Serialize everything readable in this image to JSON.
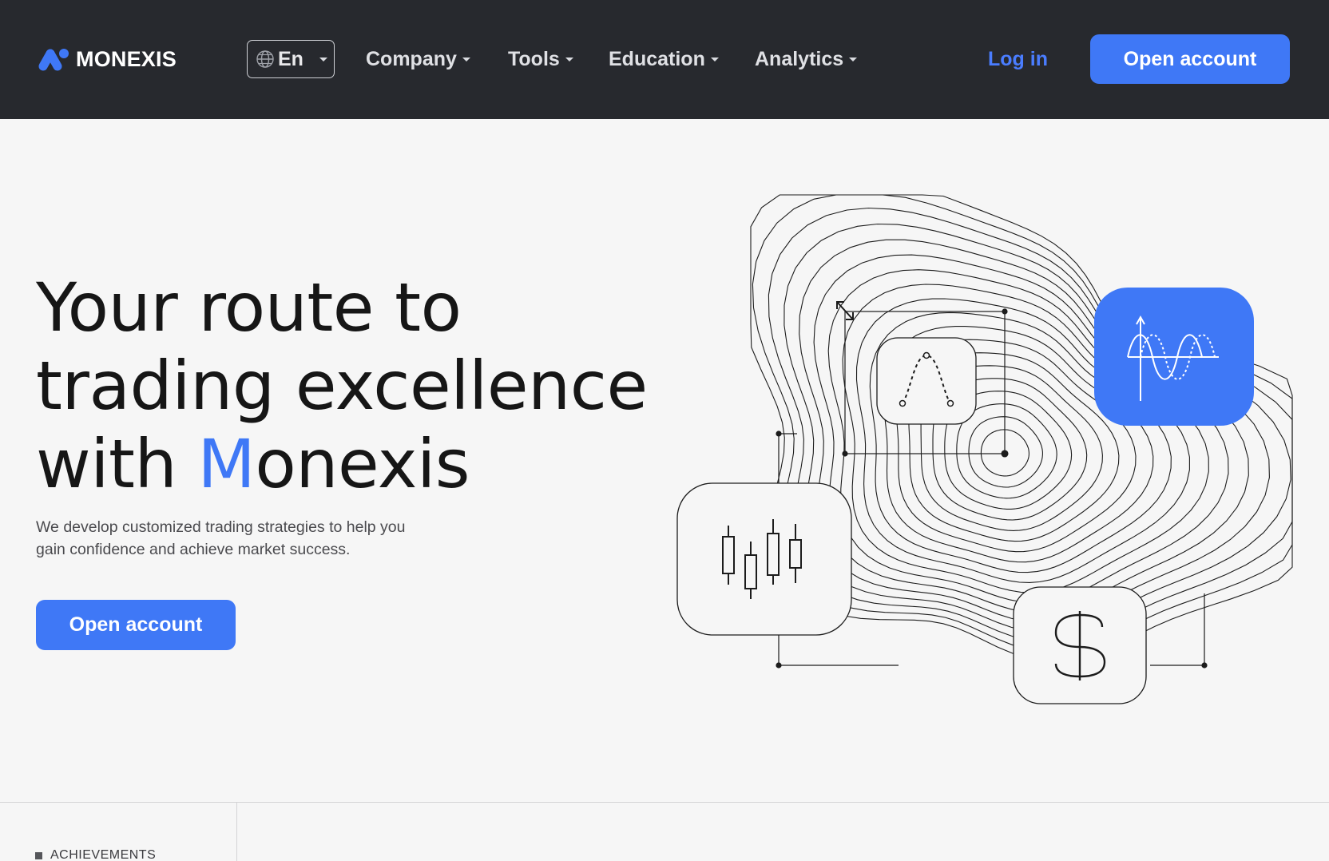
{
  "header": {
    "brand": "MONEXIS",
    "language": "En",
    "nav": [
      {
        "label": "Company"
      },
      {
        "label": "Tools"
      },
      {
        "label": "Education"
      },
      {
        "label": "Analytics"
      }
    ],
    "login_label": "Log in",
    "cta_label": "Open account"
  },
  "hero": {
    "title_line1": "Your route to",
    "title_line2": "trading excellence",
    "title_line3_prefix": "with ",
    "title_line3_accent": "M",
    "title_line3_suffix": "onexis",
    "subtitle": "We develop customized trading strategies to help you gain confidence and achieve market success.",
    "cta_label": "Open account"
  },
  "section": {
    "label": "ACHIEVEMENTS"
  },
  "colors": {
    "accent": "#3f78f6",
    "header_bg": "#27292e",
    "page_bg": "#f6f6f6"
  },
  "icons": [
    "logo-icon",
    "globe-icon",
    "chevron-down-icon",
    "candlestick-icon",
    "bell-curve-icon",
    "wave-graph-icon",
    "dollar-icon",
    "resize-arrow-icon"
  ]
}
